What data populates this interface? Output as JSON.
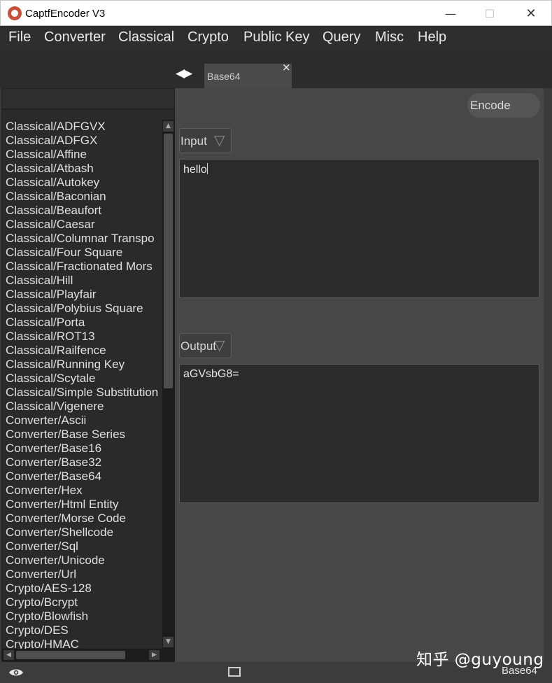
{
  "window": {
    "title": "CaptfEncoder V3",
    "min_glyph": "—",
    "max_glyph": "☐",
    "close_glyph": "✕"
  },
  "menu": [
    "File",
    "Converter",
    "Classical",
    "Crypto",
    "Public Key",
    "Query",
    "Misc",
    "Help"
  ],
  "tabs": {
    "nav_glyph": "◀▶",
    "active_label": "Base64",
    "close_glyph": "×"
  },
  "sidebar": {
    "search_value": "",
    "items": [
      "Classical/ADFGVX",
      "Classical/ADFGX",
      "Classical/Affine",
      "Classical/Atbash",
      "Classical/Autokey",
      "Classical/Baconian",
      "Classical/Beaufort",
      "Classical/Caesar",
      "Classical/Columnar Transpo",
      "Classical/Four Square",
      "Classical/Fractionated Mors",
      "Classical/Hill",
      "Classical/Playfair",
      "Classical/Polybius Square",
      "Classical/Porta",
      "Classical/ROT13",
      "Classical/Railfence",
      "Classical/Running Key",
      "Classical/Scytale",
      "Classical/Simple Substitution",
      "Classical/Vigenere",
      "Converter/Ascii",
      "Converter/Base Series",
      "Converter/Base16",
      "Converter/Base32",
      "Converter/Base64",
      "Converter/Hex",
      "Converter/Html Entity",
      "Converter/Morse Code",
      "Converter/Shellcode",
      "Converter/Sql",
      "Converter/Unicode",
      "Converter/Url",
      "Crypto/AES-128",
      "Crypto/Bcrypt",
      "Crypto/Blowfish",
      "Crypto/DES",
      "Crypto/HMAC"
    ],
    "scroll_up_glyph": "▲",
    "scroll_down_glyph": "▼",
    "scroll_left_glyph": "◀",
    "scroll_right_glyph": "▶"
  },
  "main": {
    "encode_label": "Encode",
    "input_select_label": "Input",
    "output_select_label": "Output",
    "select_arrow_glyph": "▽",
    "input_value": "hello",
    "output_value": "aGVsbG8="
  },
  "statusbar": {
    "tab_label": "Base64"
  },
  "watermark": "知乎 @guyoung",
  "icons": {
    "app": "captfencoder-logo-icon",
    "eye": "eye-icon",
    "window": "window-square-icon"
  },
  "colors": {
    "background": "#3a3a3a",
    "menubar": "#2e2e2e",
    "panel": "#474747",
    "textarea": "#2b2b2b",
    "text": "#e0e0e0"
  }
}
